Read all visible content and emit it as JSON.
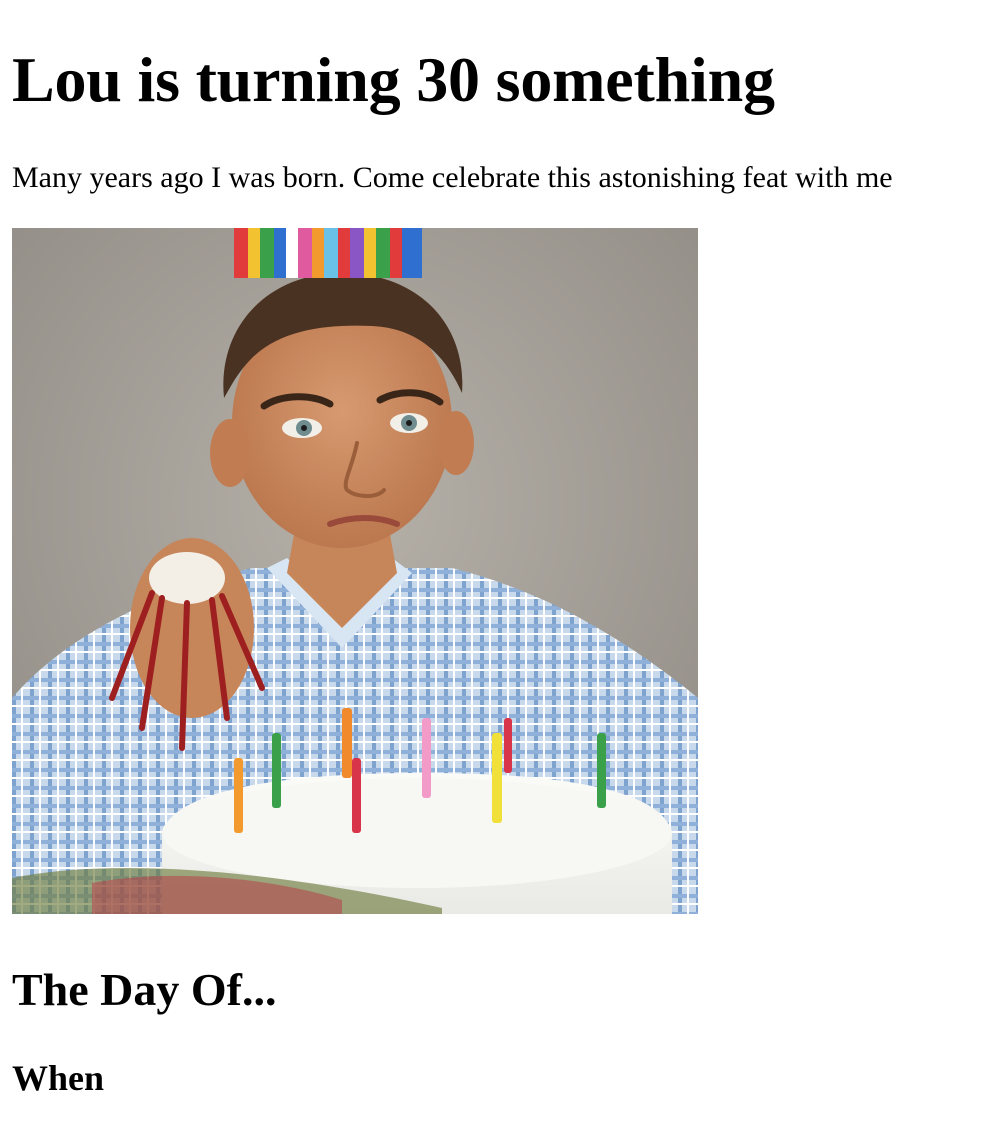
{
  "heading": "Lou is turning 30 something",
  "intro": "Many years ago I was born. Come celebrate this astonishing feat with me",
  "photo": {
    "alt": "Boy in party hat sitting behind a birthday cake"
  },
  "section_heading": "The Day Of...",
  "subheading": "When"
}
